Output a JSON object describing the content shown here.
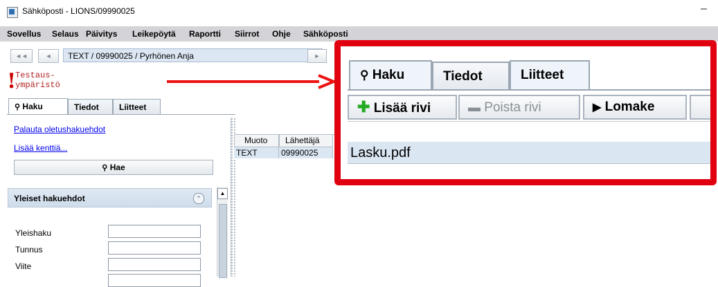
{
  "window": {
    "title": "Sähköposti - LIONS/09990025",
    "minimize": "–"
  },
  "menu": [
    "Sovellus",
    "Selaus",
    "Päivitys",
    "Leikepöytä",
    "Raportti",
    "Siirrot",
    "Ohje",
    "Sähköposti"
  ],
  "nav": {
    "first": "◄◄",
    "prev": "◄",
    "next": "►",
    "path": "TEXT / 09990025 / Pyrhönen Anja"
  },
  "environment": {
    "exclamation": "!",
    "line1": "Testaus-",
    "line2": "ympäristö"
  },
  "tabs": {
    "haku": "Haku",
    "tiedot": "Tiedot",
    "liitteet": "Liitteet"
  },
  "search_panel": {
    "reset_link": "Palauta oletushakuehdot",
    "add_field_link": "Lisää kenttiä...",
    "search_button": "Hae",
    "group_title": "Yleiset hakuehdot",
    "fields": [
      "Yleishaku",
      "Tunnus",
      "Viite"
    ]
  },
  "table": {
    "columns": [
      "Muoto",
      "Lähettäjä"
    ],
    "rows": [
      [
        "TEXT",
        "09990025"
      ]
    ]
  },
  "zoom": {
    "tabs": [
      "Haku",
      "Tiedot",
      "Liitteet"
    ],
    "buttons": {
      "add_row": "Lisää rivi",
      "remove_row": "Poista rivi",
      "form": "Lomake"
    },
    "attachment": "Lasku.pdf"
  },
  "colors": {
    "callout": "#e0000f",
    "arrow": "#ee1111",
    "env_text": "#b21f1f",
    "selected_row": "#dbe6f3"
  }
}
